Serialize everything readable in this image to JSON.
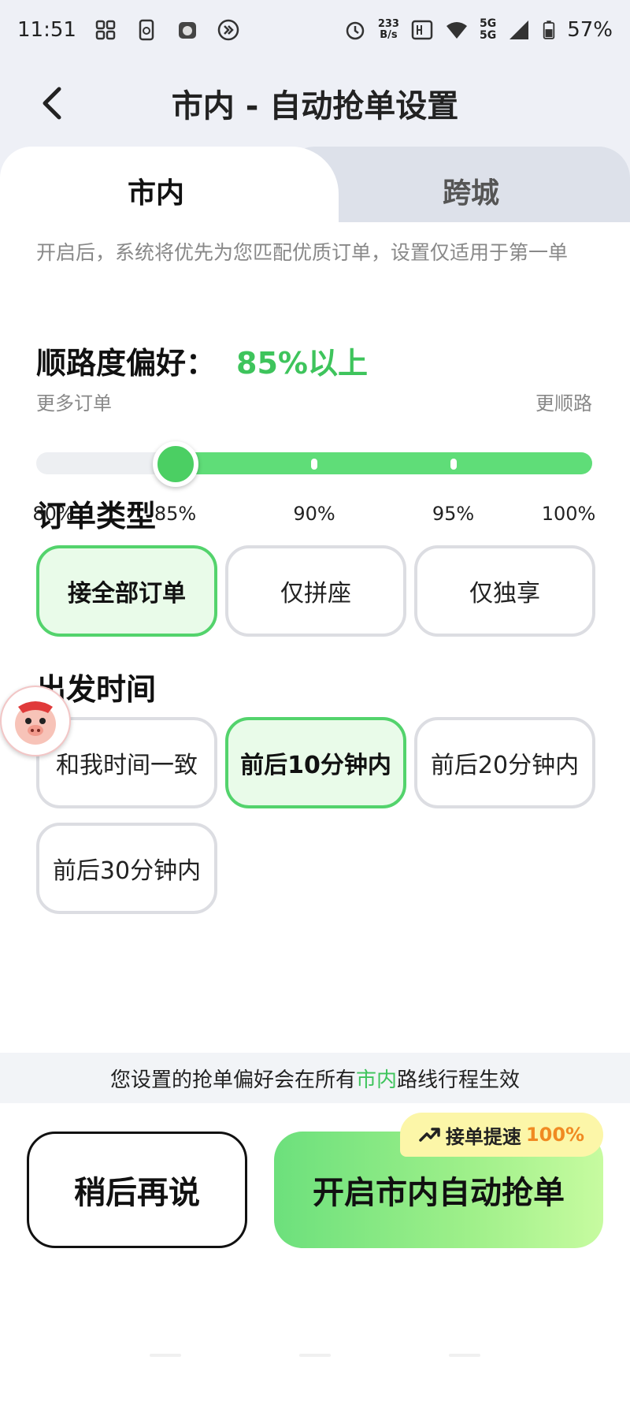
{
  "status_bar": {
    "time": "11:51",
    "net_speed_value": "233",
    "net_speed_unit": "B/s",
    "signal_5g_top": "5G",
    "signal_5g_bottom": "5G",
    "battery": "57%"
  },
  "nav": {
    "title": "市内 - 自动抢单设置"
  },
  "tabs": [
    {
      "label": "市内",
      "active": true
    },
    {
      "label": "跨城",
      "active": false
    }
  ],
  "intro": "开启后，系统将优先为您匹配优质订单，设置仅适用于第一单",
  "preference": {
    "title": "顺路度偏好：",
    "value": "85%以上",
    "left_label": "更多订单",
    "right_label": "更顺路",
    "min": 80,
    "max": 100,
    "selected": 85,
    "ticks": [
      "80%",
      "85%",
      "90%",
      "95%",
      "100%"
    ]
  },
  "order_type": {
    "title": "订单类型",
    "options": [
      "接全部订单",
      "仅拼座",
      "仅独享"
    ],
    "selected_index": 0
  },
  "departure": {
    "title": "出发时间",
    "options": [
      "和我时间一致",
      "前后10分钟内",
      "前后20分钟内",
      "前后30分钟内"
    ],
    "selected_index": 1
  },
  "notice": {
    "prefix": "您设置的抢单偏好会在所有",
    "highlight": "市内",
    "suffix": "路线行程生效"
  },
  "actions": {
    "later": "稍后再说",
    "start": "开启市内自动抢单",
    "badge_text": "接单提速",
    "badge_pct": "100%"
  },
  "colors": {
    "accent": "#3ec45c",
    "badge_pct": "#f08a22"
  }
}
